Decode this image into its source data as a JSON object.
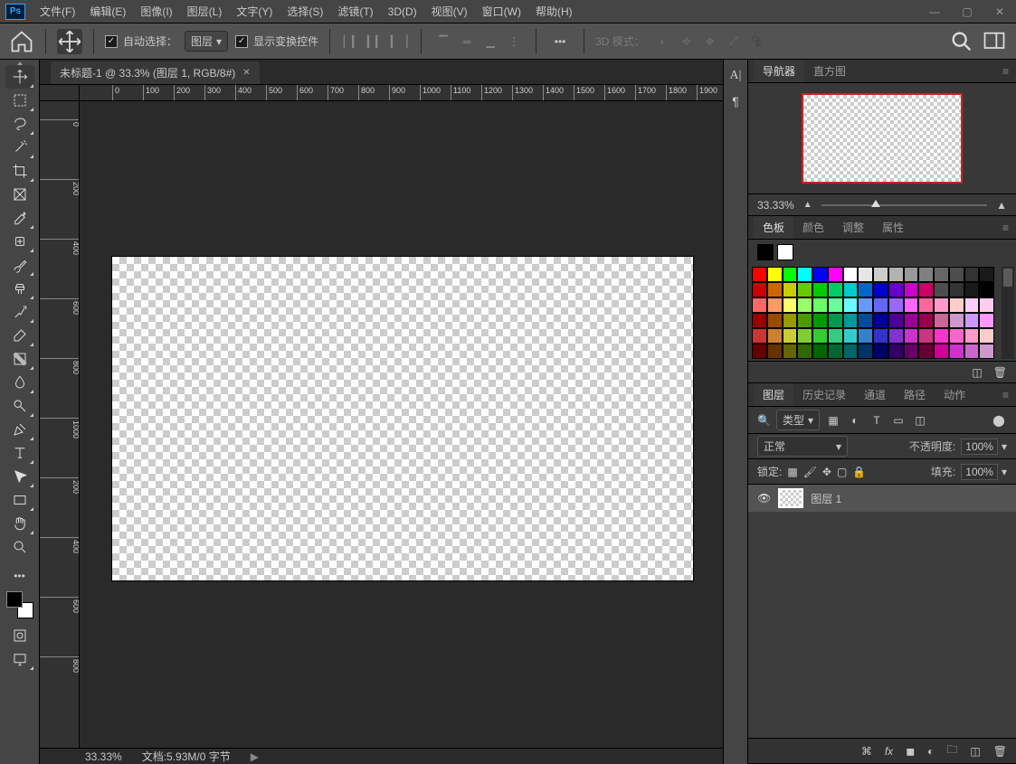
{
  "menu": {
    "items": [
      "文件(F)",
      "编辑(E)",
      "图像(I)",
      "图层(L)",
      "文字(Y)",
      "选择(S)",
      "滤镜(T)",
      "3D(D)",
      "视图(V)",
      "窗口(W)",
      "帮助(H)"
    ]
  },
  "options": {
    "auto_select_label": "自动选择：",
    "layer_select": "图层",
    "show_transform": "显示变换控件",
    "mode3d_label": "3D 模式："
  },
  "tab": {
    "title": "未标题-1 @ 33.3% (图层 1, RGB/8#)"
  },
  "status": {
    "zoom": "33.33%",
    "doc": "文档:5.93M/0 字节"
  },
  "ruler": {
    "h": [
      "0",
      "100",
      "200",
      "300",
      "400",
      "500",
      "600",
      "700",
      "800",
      "900",
      "1000",
      "1100",
      "1200",
      "1300",
      "1400",
      "1500",
      "1600",
      "1700",
      "1800",
      "1900"
    ],
    "v": [
      "0",
      "200",
      "400",
      "600",
      "800",
      "1000",
      "200",
      "400",
      "600",
      "800"
    ]
  },
  "navigator": {
    "tab1": "导航器",
    "tab2": "直方图",
    "zoom": "33.33%"
  },
  "swatches": {
    "tabs": [
      "色板",
      "颜色",
      "调整",
      "属性"
    ],
    "colors": [
      "#ff0000",
      "#ffff00",
      "#00ff00",
      "#00ffff",
      "#0000ff",
      "#ff00ff",
      "#ffffff",
      "#e6e6e6",
      "#cccccc",
      "#b3b3b3",
      "#999999",
      "#808080",
      "#666666",
      "#4d4d4d",
      "#333333",
      "#1a1a1a",
      "#cc0000",
      "#cc6600",
      "#cccc00",
      "#66cc00",
      "#00cc00",
      "#00cc66",
      "#00cccc",
      "#0066cc",
      "#0000cc",
      "#6600cc",
      "#cc00cc",
      "#cc0066",
      "#4d4d4d",
      "#333333",
      "#1a1a1a",
      "#000000",
      "#ff6666",
      "#ff9966",
      "#ffff66",
      "#99ff66",
      "#66ff66",
      "#66ff99",
      "#66ffff",
      "#6699ff",
      "#6666ff",
      "#9966ff",
      "#ff66ff",
      "#ff6699",
      "#ff99cc",
      "#ffcccc",
      "#ffccff",
      "#ffccee",
      "#990000",
      "#994c00",
      "#999900",
      "#4c9900",
      "#009900",
      "#00994c",
      "#009999",
      "#004c99",
      "#000099",
      "#4c0099",
      "#990099",
      "#99004c",
      "#cc6699",
      "#cc99cc",
      "#cc99ff",
      "#ff99ff",
      "#cc3333",
      "#cc8033",
      "#cccc33",
      "#80cc33",
      "#33cc33",
      "#33cc80",
      "#33cccc",
      "#3380cc",
      "#3333cc",
      "#8033cc",
      "#cc33cc",
      "#cc3380",
      "#ff33cc",
      "#ff66cc",
      "#ff99cc",
      "#ffcccc",
      "#660000",
      "#663300",
      "#666600",
      "#336600",
      "#006600",
      "#006633",
      "#006666",
      "#003366",
      "#000066",
      "#330066",
      "#660066",
      "#660033",
      "#cc0099",
      "#cc33cc",
      "#cc66cc",
      "#cc99cc"
    ]
  },
  "layers": {
    "tabs": [
      "图层",
      "历史记录",
      "通道",
      "路径",
      "动作"
    ],
    "filter_label": "类型",
    "blend_mode": "正常",
    "opacity_label": "不透明度:",
    "opacity_value": "100%",
    "lock_label": "锁定:",
    "fill_label": "填充:",
    "fill_value": "100%",
    "items": [
      {
        "name": "图层 1"
      }
    ]
  }
}
